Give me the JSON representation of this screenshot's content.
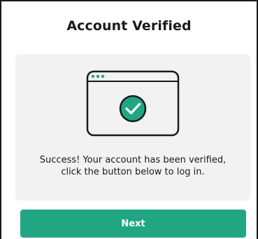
{
  "page": {
    "title": "Account Verified"
  },
  "card": {
    "message_line1": "Success! Your account has been verified,",
    "message_line2": "click the button below to log in.",
    "illustration": {
      "window_icon": "browser-window-icon",
      "check_icon": "check-circle-icon"
    }
  },
  "actions": {
    "next_label": "Next"
  },
  "colors": {
    "accent": "#21a683",
    "card_background": "#f2f2f2",
    "text": "#1a1a1a"
  }
}
